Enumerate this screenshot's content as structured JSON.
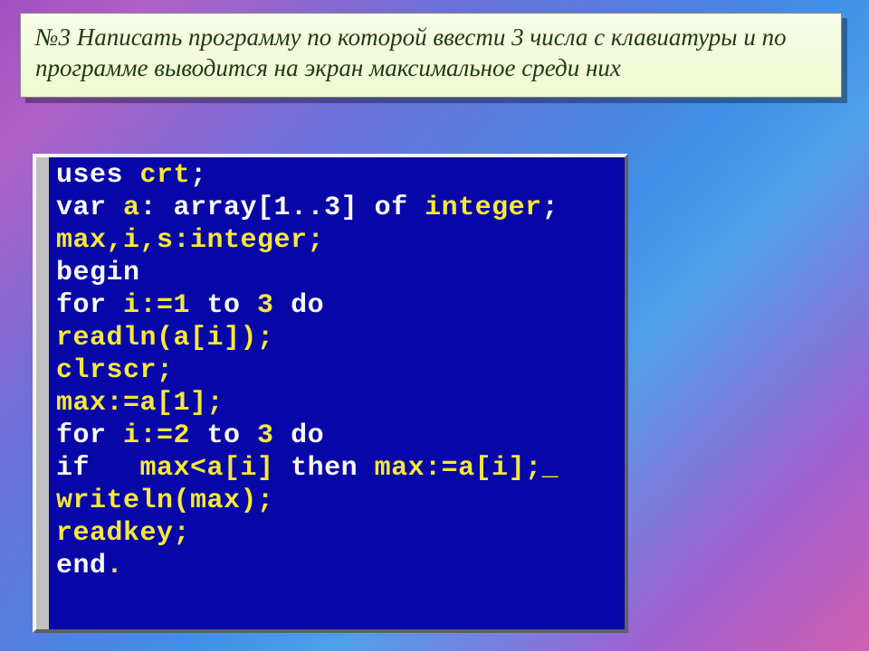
{
  "task": {
    "text": "№3  Написать программу по которой ввести 3 числа с клавиатуры и по программе выводится на экран максимальное среди них"
  },
  "code": {
    "line1_a": "uses ",
    "line1_b": "crt",
    "line1_c": ";",
    "line2_a": "var ",
    "line2_b": "a",
    "line2_c": ": array[1..3] ",
    "line2_d": "of ",
    "line2_e": "integer",
    "line2_f": ";",
    "line3_a": "max,i,s:integer;",
    "line4_a": "begin",
    "line5_a": "for ",
    "line5_b": "i:=1",
    "line5_c": " to ",
    "line5_d": "3",
    "line5_e": " do",
    "line6_a": "readln(a[i]);",
    "line7_a": "clrscr;",
    "line8_a": "max:=a[1];",
    "line9_a": "for ",
    "line9_b": "i:=2",
    "line9_c": " to ",
    "line9_d": "3",
    "line9_e": " do",
    "line10_a": "if",
    "line10_b": "   max<a[i] ",
    "line10_c": "then ",
    "line10_d": "max:=a[i];",
    "line10_cur": "_",
    "line11_a": "writeln(max);",
    "line12_a": "readkey;",
    "line13_a": "end",
    "line13_b": "."
  }
}
